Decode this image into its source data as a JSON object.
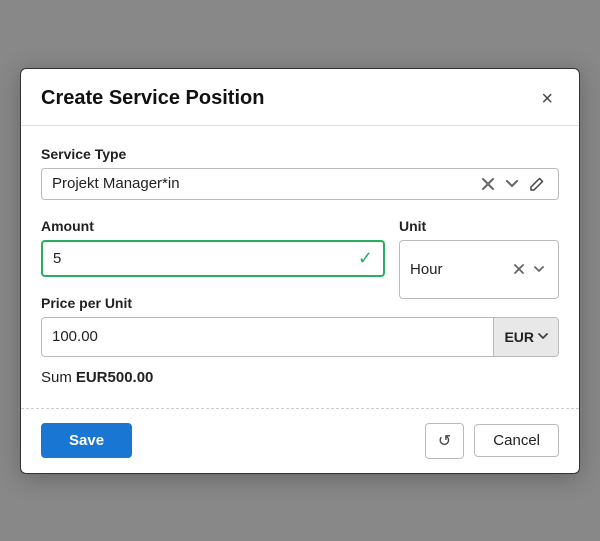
{
  "dialog": {
    "title": "Create Service Position",
    "close_label": "×"
  },
  "service_type": {
    "label": "Service Type",
    "value": "Projekt Manager*in"
  },
  "amount": {
    "label": "Amount",
    "value": "5"
  },
  "unit": {
    "label": "Unit",
    "value": "Hour"
  },
  "price_per_unit": {
    "label": "Price per Unit",
    "value": "100.00",
    "currency": "EUR"
  },
  "sum": {
    "label": "Sum",
    "value": "EUR500.00"
  },
  "footer": {
    "save_label": "Save",
    "cancel_label": "Cancel",
    "reset_icon": "↺"
  }
}
